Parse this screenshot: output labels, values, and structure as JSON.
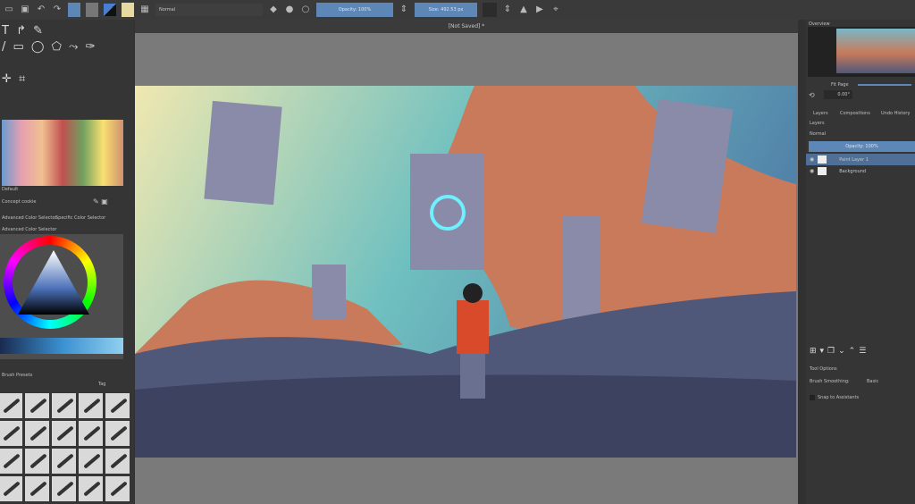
{
  "toolbar": {
    "blend_mode": "Normal",
    "opacity": "Opacity: 100%",
    "size": "Size: 492.53 px"
  },
  "document": {
    "title": "[Not Saved] *"
  },
  "left": {
    "palette_title": "Default",
    "concept_label": "Concept cookie",
    "tabs": [
      "Advanced Color Selector",
      "Specific Color Selector"
    ],
    "color_selector_title": "Advanced Color Selector",
    "presets_title": "Brush Presets",
    "tag_label": "Tag"
  },
  "right": {
    "overview_title": "Overview",
    "fit_page": "Fit Page",
    "rotation": "0.00°",
    "tabs": [
      "Layers",
      "Compositions",
      "Undo History"
    ],
    "layers_title": "Layers",
    "blend_mode": "Normal",
    "opacity": "Opacity: 100%",
    "layers": [
      {
        "name": "Paint Layer 1",
        "selected": true
      },
      {
        "name": "Background",
        "selected": false
      }
    ],
    "tool_options_title": "Tool Options",
    "brush_smoothing_label": "Brush Smoothing:",
    "brush_smoothing_value": "Basic",
    "snap_label": "Snap to Assistants"
  }
}
